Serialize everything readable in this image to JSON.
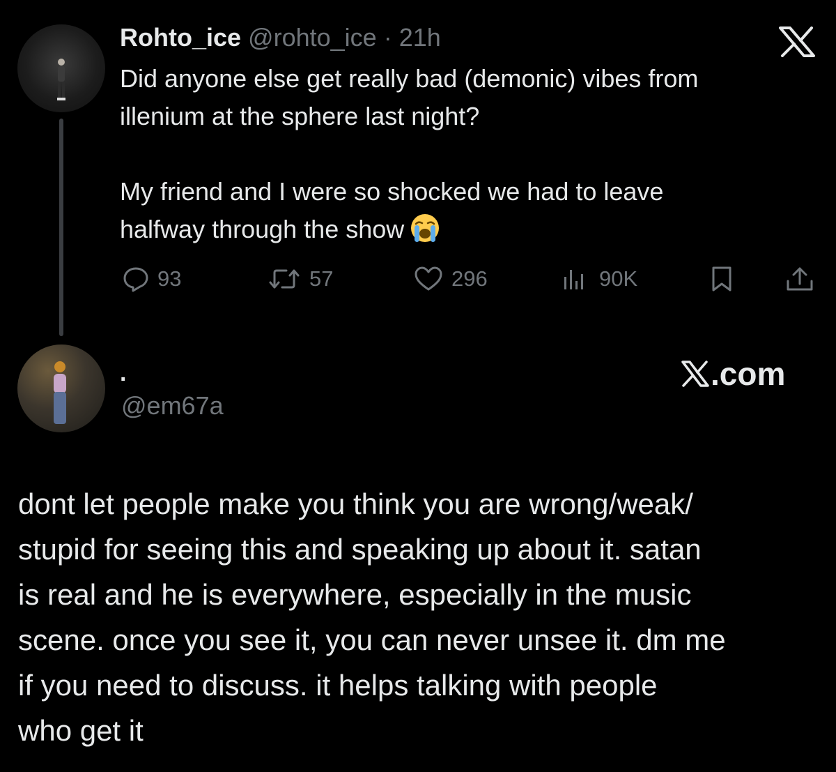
{
  "tweet": {
    "display_name": "Rohto_ice",
    "handle": "@rohto_ice",
    "separator": "·",
    "time": "21h",
    "text_paragraph_1_line_1": "Did anyone else get really bad (demonic) vibes from",
    "text_paragraph_1_line_2": "illenium at the sphere last night?",
    "text_paragraph_2_line_1": "My friend and I were so shocked we had to leave",
    "text_paragraph_2_line_2": "halfway through the show",
    "emoji": "loudly-crying-face",
    "actions": {
      "replies": "93",
      "retweets": "57",
      "likes": "296",
      "views": "90K"
    }
  },
  "reply": {
    "display_name": "·",
    "handle": "@em67a",
    "brand_label": ".com",
    "text_lines": [
      "dont let people make you think you are wrong/weak/",
      "stupid for seeing this and speaking up about it. satan",
      "is real and he is everywhere, especially in the music",
      "scene. once you see it, you can never unsee it. dm me",
      "if you need to discuss. it helps talking with people",
      "who get it"
    ]
  },
  "colors": {
    "background": "#000000",
    "text": "#e7e9ea",
    "muted": "#71767b",
    "thread_line": "#3a3d41"
  },
  "icons": [
    "x-logo-icon",
    "reply-icon",
    "retweet-icon",
    "like-icon",
    "views-icon",
    "bookmark-icon",
    "share-icon"
  ]
}
